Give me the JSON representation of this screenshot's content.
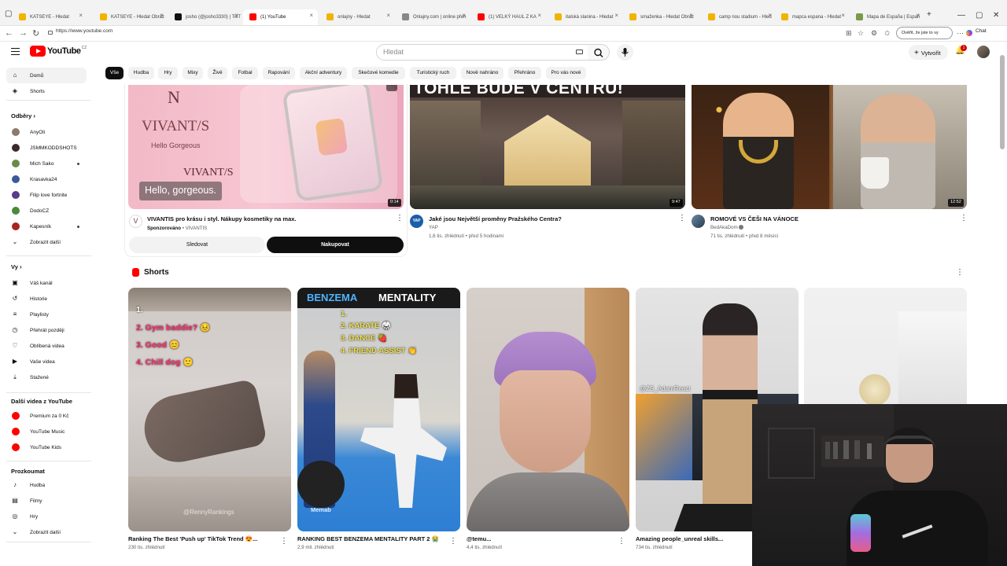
{
  "browser": {
    "tabs": [
      {
        "label": "KATSEYE - Hledat",
        "color": "#f0b400"
      },
      {
        "label": "KATSEYE - Hledat Obráz",
        "color": "#f0b400"
      },
      {
        "label": "josho (@josho3330) | TikT",
        "color": "#111111"
      },
      {
        "label": "(1) YouTube",
        "color": "#ff0000"
      },
      {
        "label": "onlajny - Hledat",
        "color": "#f0b400"
      },
      {
        "label": "Onlajny.com | online přen",
        "color": "#888888"
      },
      {
        "label": "(1) VELKÝ HAUL Z KA",
        "color": "#ff0000"
      },
      {
        "label": "italská slanina - Hledat",
        "color": "#f0b400"
      },
      {
        "label": "smaženka - Hledat Obráz",
        "color": "#f0b400"
      },
      {
        "label": "camp nou stadium - Hled",
        "color": "#f0b400"
      },
      {
        "label": "mapca espana - Hledat",
        "color": "#f0b400"
      },
      {
        "label": "Mapa de España | Españ",
        "color": "#7a9a4a"
      }
    ],
    "url": "https://www.youtube.com",
    "profile_chip": "Ověřit, že jste to vy",
    "chat_label": "Chat"
  },
  "header": {
    "logo_text": "YouTube",
    "country_code": "CZ",
    "search_placeholder": "Hledat",
    "create_label": "Vytvořit",
    "notification_count": "1"
  },
  "chips": [
    "Vše",
    "Hudba",
    "Hry",
    "Mixy",
    "Živě",
    "Fotbal",
    "Rapování",
    "Akční adventury",
    "Skečové komedie",
    "Turistický ruch",
    "Nově nahráno",
    "Přehráno",
    "Pro vás nové"
  ],
  "sidebar": {
    "top": [
      {
        "label": "Domů",
        "icon": "home-icon"
      },
      {
        "label": "Shorts",
        "icon": "shorts-icon"
      }
    ],
    "subscriptions_heading": "Odběry",
    "subscriptions": [
      {
        "label": "AnyOli",
        "color": "#8c7a6b",
        "dot": false
      },
      {
        "label": "JSMMKODDSHOTS",
        "color": "#3a2a2a",
        "dot": false
      },
      {
        "label": "Mich Sako",
        "color": "#6b8a4a",
        "dot": true
      },
      {
        "label": "Krasavka24",
        "color": "#3b5998",
        "dot": false
      },
      {
        "label": "Filip love fortnite",
        "color": "#5a3a8a",
        "dot": false
      },
      {
        "label": "DodoCZ",
        "color": "#4a8a3a",
        "dot": false
      },
      {
        "label": "Kapesník",
        "color": "#aa2222",
        "dot": true
      },
      {
        "label": "Zobrazit další",
        "color": "",
        "dot": false
      }
    ],
    "you_heading": "Vy",
    "you": [
      {
        "label": "Váš kanál",
        "icon": "channel-icon"
      },
      {
        "label": "Historie",
        "icon": "history-icon"
      },
      {
        "label": "Playlisty",
        "icon": "playlist-icon"
      },
      {
        "label": "Přehrát později",
        "icon": "watch-later-icon"
      },
      {
        "label": "Oblíbená videa",
        "icon": "like-icon"
      },
      {
        "label": "Vaše videa",
        "icon": "your-videos-icon"
      },
      {
        "label": "Stažené",
        "icon": "download-icon"
      }
    ],
    "more_heading": "Další videa z YouTube",
    "more": [
      {
        "label": "Premium za 0 Kč"
      },
      {
        "label": "YouTube Music"
      },
      {
        "label": "YouTube Kids"
      }
    ],
    "explore_heading": "Prozkoumat",
    "explore": [
      {
        "label": "Hudba",
        "icon": "music-icon"
      },
      {
        "label": "Filmy",
        "icon": "movies-icon"
      },
      {
        "label": "Hry",
        "icon": "gaming-icon"
      },
      {
        "label": "Zobrazit další",
        "icon": "chevron-down-icon"
      }
    ]
  },
  "videos": [
    {
      "title": "VIVANTIS pro krásu i styl. Nákupy kosmetiky na max.",
      "sponsored": "Sponzorováno",
      "channel": "VIVANTIS",
      "duration": "0:14",
      "overlay_brand": "VIVANT/S",
      "overlay_sub": "Hello Gorgeous",
      "overlay_caption": "Hello, gorgeous.",
      "follow_label": "Sledovat",
      "shop_label": "Nakupovat"
    },
    {
      "title": "Jaké jsou Největší proměny Pražského Centra?",
      "channel": "YAP",
      "meta": "1,6 tis. zhlédnutí • před 5 hodinami",
      "duration": "9:47",
      "overlay_text": "TOHLE BUDE V CENTRU!",
      "avatar_text": "YAP"
    },
    {
      "title": "ROMOVÉ VS ČEŠI NA VÁNOCE",
      "channel": "BedAkaDom",
      "meta": "71 tis. zhlédnutí • před 8 měsíci",
      "duration": "12:52"
    }
  ],
  "shorts": {
    "heading": "Shorts",
    "items": [
      {
        "title": "Ranking The Best 'Push up' TikTok Trend 😍...",
        "views": "230 tis. zhlédnutí",
        "overlay": [
          "1.",
          "2. Gym baddie? 😣",
          "3. Good 😊",
          "4. Chill dog 🙂"
        ],
        "watermark": "@RennyRankings"
      },
      {
        "title": "RANKING BEST BENZEMA MENTALITY PART 2 😭",
        "views": "2,9 mil. zhlédnutí",
        "overlay_head_a": "BENZEMA",
        "overlay_head_b": "MENTALITY",
        "overlay": [
          "1.",
          "2. KARATE 🥋",
          "3. DANCE 🍓",
          "4. FRIEND ASSIST 👏"
        ],
        "watermark": "Memab"
      },
      {
        "title": "@temu...",
        "views": "4,4 tis. zhlédnutí"
      },
      {
        "title": "Amazing people_unreal skills...",
        "views": "734 tis. zhlédnutí",
        "watermark": "@ZS_AdamReact"
      },
      {
        "title": "",
        "views": ""
      }
    ]
  }
}
